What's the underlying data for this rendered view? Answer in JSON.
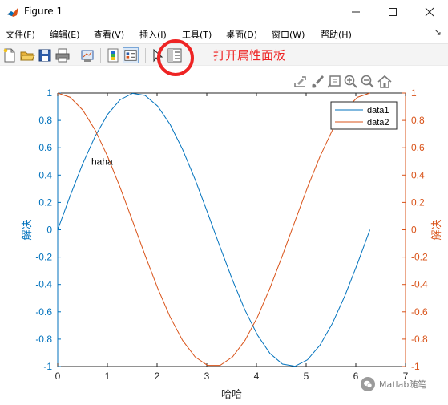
{
  "window": {
    "title": "Figure 1",
    "minimize_icon": "minimize-icon",
    "maximize_icon": "maximize-icon",
    "close_icon": "close-icon"
  },
  "menu": {
    "items": [
      "文件(F)",
      "编辑(E)",
      "查看(V)",
      "插入(I)",
      "工具(T)",
      "桌面(D)",
      "窗口(W)",
      "帮助(H)"
    ],
    "extra": "↘"
  },
  "toolbar": {
    "buttons": [
      "new-figure-icon",
      "open-icon",
      "save-icon",
      "print-icon",
      "link-plot-icon",
      "insert-colorbar-icon",
      "insert-legend-icon",
      "edit-plot-icon",
      "property-inspector-icon"
    ],
    "active": "insert-legend-icon"
  },
  "annotation": {
    "label": "打开属性面板",
    "color": "#ee2424"
  },
  "axes_toolbar": {
    "icons": [
      "export-icon",
      "brush-icon",
      "datatip-icon",
      "zoom-in-icon",
      "zoom-out-icon",
      "home-icon"
    ]
  },
  "chart_data": {
    "type": "line",
    "xlabel": "哈哈",
    "ylabel_left": "解决",
    "ylabel_right": "解决",
    "xlim": [
      0,
      7
    ],
    "ylim_left": [
      -1,
      1
    ],
    "ylim_right": [
      -1,
      1
    ],
    "xticks": [
      "0",
      "1",
      "2",
      "3",
      "4",
      "5",
      "6",
      "7"
    ],
    "yticks_left": [
      "-1",
      "-0.8",
      "-0.6",
      "-0.4",
      "-0.2",
      "0",
      "0.2",
      "0.4",
      "0.6",
      "0.8",
      "1"
    ],
    "yticks_right": [
      "-1",
      "-0.8",
      "-0.6",
      "-0.4",
      "-0.2",
      "0",
      "0.2",
      "0.4",
      "0.6",
      "0.8",
      "1"
    ],
    "grid": false,
    "legend_position": "top-right",
    "text_annotation": {
      "text": "haha",
      "x": 1,
      "y": 0.5
    },
    "series": [
      {
        "name": "data1",
        "color": "#0072bd",
        "axis": "left",
        "x": [
          0,
          0.2513,
          0.5027,
          0.754,
          1.0053,
          1.2566,
          1.508,
          1.7593,
          2.0106,
          2.2619,
          2.5133,
          2.7646,
          3.0159,
          3.2673,
          3.5186,
          3.7699,
          4.0212,
          4.2726,
          4.5239,
          4.7752,
          5.0265,
          5.2779,
          5.5292,
          5.7805,
          6.0319,
          6.2832
        ],
        "y": [
          0,
          0.2487,
          0.4818,
          0.6845,
          0.8443,
          0.9511,
          0.998,
          0.9823,
          0.9048,
          0.7705,
          0.5878,
          0.3681,
          0.1253,
          -0.1253,
          -0.3681,
          -0.5878,
          -0.7705,
          -0.9048,
          -0.9823,
          -0.998,
          -0.9511,
          -0.8443,
          -0.6845,
          -0.4818,
          -0.2487,
          0
        ]
      },
      {
        "name": "data2",
        "color": "#d95319",
        "axis": "right",
        "x": [
          0,
          0.2513,
          0.5027,
          0.754,
          1.0053,
          1.2566,
          1.508,
          1.7593,
          2.0106,
          2.2619,
          2.5133,
          2.7646,
          3.0159,
          3.2673,
          3.5186,
          3.7699,
          4.0212,
          4.2726,
          4.5239,
          4.7752,
          5.0265,
          5.2779,
          5.5292,
          5.7805,
          6.0319,
          6.2832
        ],
        "y": [
          1,
          0.9686,
          0.8763,
          0.729,
          0.5358,
          0.309,
          0.0628,
          -0.1874,
          -0.4258,
          -0.6374,
          -0.809,
          -0.9298,
          -0.9921,
          -0.9921,
          -0.9298,
          -0.809,
          -0.6374,
          -0.4258,
          -0.1874,
          0.0628,
          0.309,
          0.5358,
          0.729,
          0.8763,
          0.9686,
          1
        ]
      }
    ]
  },
  "watermark": {
    "text": "Matlab随笔",
    "icon": "wechat-icon"
  }
}
